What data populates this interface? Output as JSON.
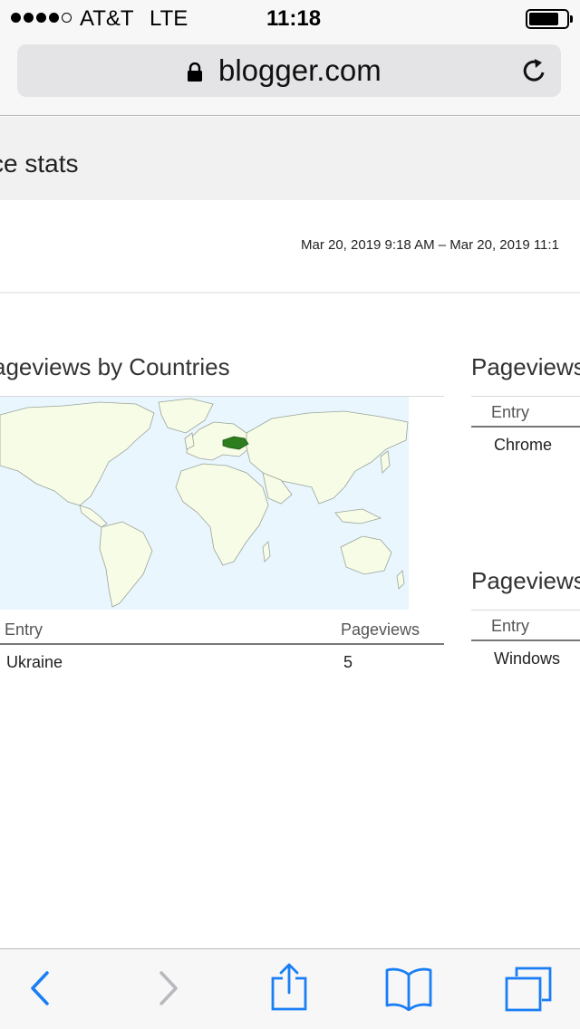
{
  "status_bar": {
    "carrier": "AT&T",
    "network": "LTE",
    "time": "11:18",
    "battery_level": 0.8
  },
  "url_bar": {
    "domain": "blogger.com"
  },
  "page": {
    "title": "ce stats",
    "date_range": "Mar 20, 2019 9:18 AM – Mar 20, 2019 11:1"
  },
  "countries": {
    "title": "ageviews by Countries",
    "columns": [
      "Entry",
      "Pageviews"
    ],
    "rows": [
      {
        "entry": "Ukraine",
        "pageviews": "5"
      }
    ],
    "highlight_color": "#2e7d1f"
  },
  "browsers": {
    "title": "Pageviews",
    "column": "Entry",
    "rows": [
      {
        "entry": "Chrome"
      }
    ]
  },
  "operating_systems": {
    "title": "Pageviews",
    "column": "Entry",
    "rows": [
      {
        "entry": "Windows"
      }
    ]
  },
  "toolbar": {
    "icons": [
      "back-icon",
      "forward-icon",
      "share-icon",
      "bookmarks-icon",
      "tabs-icon"
    ],
    "accent_color": "#1a7ef5",
    "disabled_color": "#b8b8bd"
  }
}
